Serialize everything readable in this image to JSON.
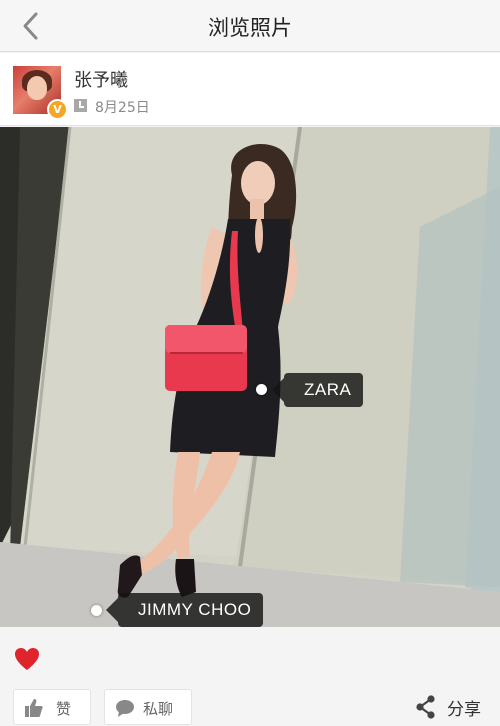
{
  "header": {
    "title": "浏览照片"
  },
  "post": {
    "username": "张予曦",
    "verified_badge": "V",
    "date": "8月25日"
  },
  "photo": {
    "tags": [
      {
        "label": "ZARA"
      },
      {
        "label": "JIMMY CHOO"
      }
    ]
  },
  "actions": {
    "like_label": "赞",
    "message_label": "私聊",
    "share_label": "分享"
  },
  "colors": {
    "badge": "#f5a623",
    "heart": "#e0242b",
    "bag": "#e8394f"
  }
}
